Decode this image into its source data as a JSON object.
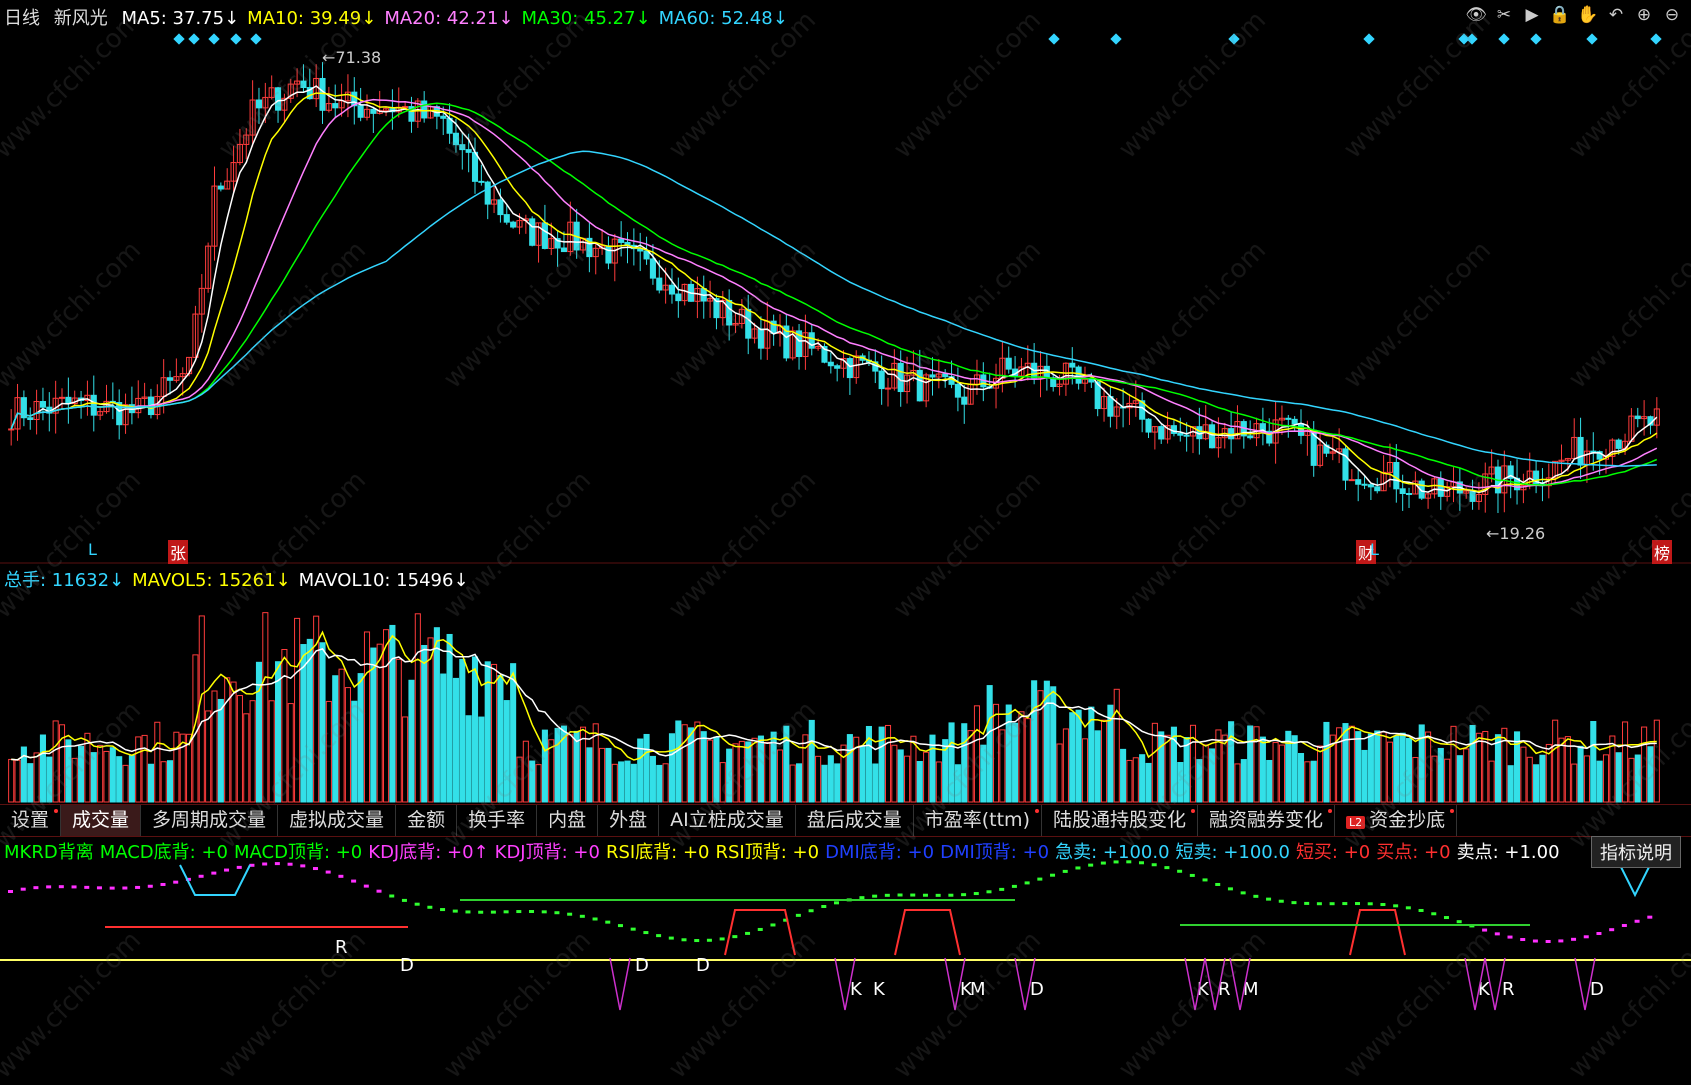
{
  "header": {
    "period": "日线",
    "stock": "新风光",
    "ma": [
      {
        "label": "MA5: 37.75↓",
        "color": "#ffffff"
      },
      {
        "label": "MA10: 39.49↓",
        "color": "#ffff00"
      },
      {
        "label": "MA20: 42.21↓",
        "color": "#ff80ff"
      },
      {
        "label": "MA30: 45.27↓",
        "color": "#00ff00"
      },
      {
        "label": "MA60: 52.48↓",
        "color": "#33d5ff"
      }
    ]
  },
  "toolbar_icons": [
    "eye-icon",
    "scissors-icon",
    "play-icon",
    "lock-icon",
    "hand-icon",
    "undo-icon",
    "zoom-in-icon",
    "zoom-out-icon"
  ],
  "price_marks": {
    "high": "71.38",
    "low": "19.26"
  },
  "tags": {
    "l1": "L",
    "zhang": "张",
    "cai": "财",
    "l2": "L",
    "bang": "榜"
  },
  "volume": {
    "header": [
      {
        "label": "总手: 11632↓",
        "color": "#33d5ff"
      },
      {
        "label": "MAVOL5: 15261↓",
        "color": "#ffff00"
      },
      {
        "label": "MAVOL10: 15496↓",
        "color": "#ffffff"
      }
    ]
  },
  "tabs": [
    {
      "label": "设置",
      "dot": true
    },
    {
      "label": "成交量",
      "active": true
    },
    {
      "label": "多周期成交量"
    },
    {
      "label": "虚拟成交量"
    },
    {
      "label": "金额"
    },
    {
      "label": "换手率"
    },
    {
      "label": "内盘"
    },
    {
      "label": "外盘"
    },
    {
      "label": "AI立桩成交量"
    },
    {
      "label": "盘后成交量"
    },
    {
      "label": "市盈率(ttm)",
      "dot": true
    },
    {
      "label": "陆股通持股变化",
      "dot": true
    },
    {
      "label": "融资融券变化",
      "dot": true
    },
    {
      "label": "资金抄底",
      "dot": true,
      "l2": "L2"
    }
  ],
  "indicator": {
    "header": [
      {
        "label": "MKRD背离",
        "color": "#00ff00"
      },
      {
        "label": "MACD底背: +0",
        "color": "#00ff00"
      },
      {
        "label": "MACD顶背: +0",
        "color": "#00ff00"
      },
      {
        "label": "KDJ底背: +0↑",
        "color": "#ff40ff"
      },
      {
        "label": "KDJ顶背: +0",
        "color": "#ff40ff"
      },
      {
        "label": "RSI底背: +0",
        "color": "#ffff00"
      },
      {
        "label": "RSI顶背: +0",
        "color": "#ffff00"
      },
      {
        "label": "DMI底背: +0",
        "color": "#2040ff"
      },
      {
        "label": "DMI顶背: +0",
        "color": "#2040ff"
      },
      {
        "label": "急卖: +100.0",
        "color": "#33d5ff"
      },
      {
        "label": "短卖: +100.0",
        "color": "#33d5ff"
      },
      {
        "label": "短买: +0",
        "color": "#ff3030"
      },
      {
        "label": "买点: +0",
        "color": "#ff3030"
      },
      {
        "label": "卖点: +1.00",
        "color": "#ffffff"
      }
    ],
    "help": "指标说明",
    "letters": [
      "R",
      "D",
      "D",
      "D",
      "K",
      "K",
      "K",
      "M",
      "D",
      "K",
      "R",
      "M",
      "K",
      "R",
      "D"
    ]
  }
}
